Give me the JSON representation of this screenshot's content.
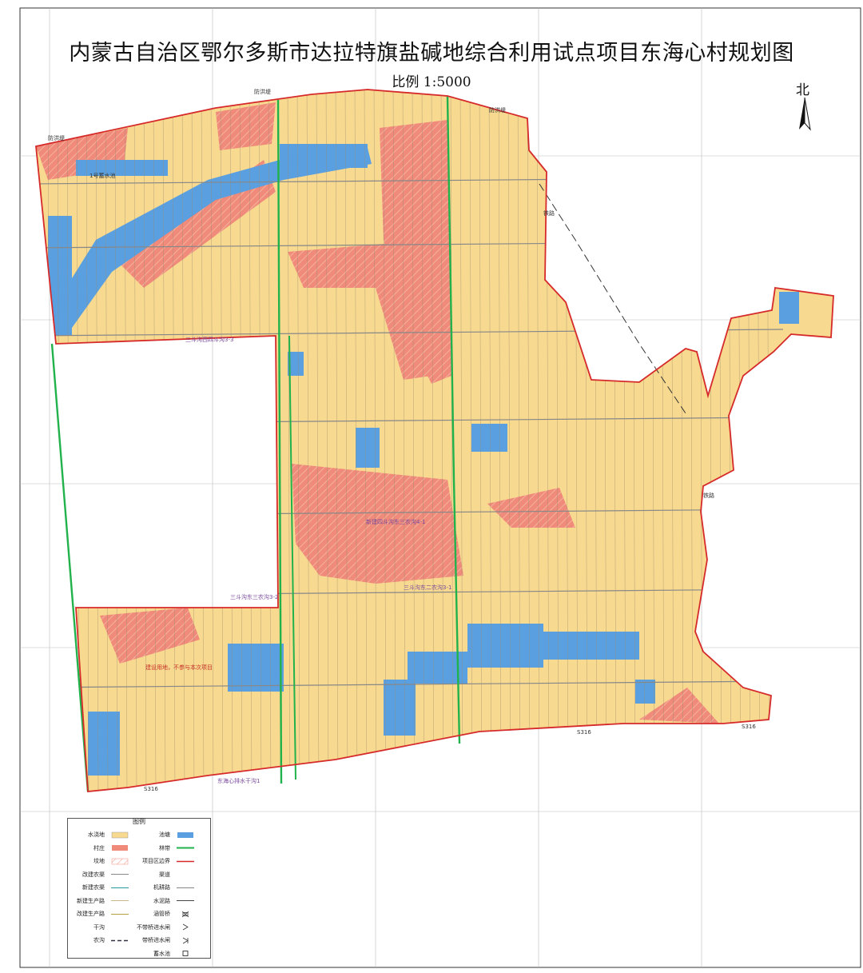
{
  "title": "内蒙古自治区鄂尔多斯市达拉特旗盐碱地综合利用试点项目东海心村规划图",
  "scale": "比例 1:5000",
  "north": "北",
  "colors": {
    "paddy": "#f7d98f",
    "village": "#f08a7a",
    "pond": "#5aa0e0",
    "forest": "#22b24c",
    "boundary": "#d62a2a",
    "road": "#8a8a8a"
  },
  "legend": {
    "title": "图例",
    "left": [
      {
        "label": "水浇地",
        "symbol": "paddy"
      },
      {
        "label": "村庄",
        "symbol": "village"
      },
      {
        "label": "坟地",
        "symbol": "grave"
      },
      {
        "label": "改建农渠",
        "symbol": "line-gray"
      },
      {
        "label": "新建农渠",
        "symbol": "line-teal"
      },
      {
        "label": "新建生产路",
        "symbol": "line-light"
      },
      {
        "label": "改建生产路",
        "symbol": "line-olive"
      },
      {
        "label": "干沟",
        "symbol": "none"
      },
      {
        "label": "农沟",
        "symbol": "dash"
      }
    ],
    "right": [
      {
        "label": "池塘",
        "symbol": "pond"
      },
      {
        "label": "林带",
        "symbol": "line-green"
      },
      {
        "label": "项目区边界",
        "symbol": "line-red"
      },
      {
        "label": "渠道",
        "symbol": "none"
      },
      {
        "label": "机耕路",
        "symbol": "line-gray"
      },
      {
        "label": "水泥路",
        "symbol": "line-dark"
      },
      {
        "label": "涵管桥",
        "symbol": "bridge"
      },
      {
        "label": "不带桥进水闸",
        "symbol": "gate"
      },
      {
        "label": "带桥进水闸",
        "symbol": "gate2"
      },
      {
        "label": "蓄水池",
        "symbol": "box"
      }
    ]
  },
  "map_labels": [
    {
      "text": "防洪堤",
      "kind": "dark"
    },
    {
      "text": "防洪堤",
      "kind": "dark"
    },
    {
      "text": "防洪堤",
      "kind": "dark"
    },
    {
      "text": "1号蓄水池",
      "kind": "dark"
    },
    {
      "text": "铁路",
      "kind": "dark"
    },
    {
      "text": "铁路",
      "kind": "dark"
    },
    {
      "text": "S316",
      "kind": "dark"
    },
    {
      "text": "S316",
      "kind": "dark"
    },
    {
      "text": "S316",
      "kind": "dark"
    },
    {
      "text": "三斗沟东三农沟3-2",
      "kind": "purple"
    },
    {
      "text": "三斗沟东二农沟3-1",
      "kind": "purple"
    },
    {
      "text": "新建四斗沟东三农沟4-1",
      "kind": "purple"
    },
    {
      "text": "东海心排水干沟1",
      "kind": "purple"
    },
    {
      "text": "建设用地，不参与本次项目",
      "kind": "red"
    },
    {
      "text": "三斗沟西四斗沟3-3",
      "kind": "purple"
    }
  ]
}
